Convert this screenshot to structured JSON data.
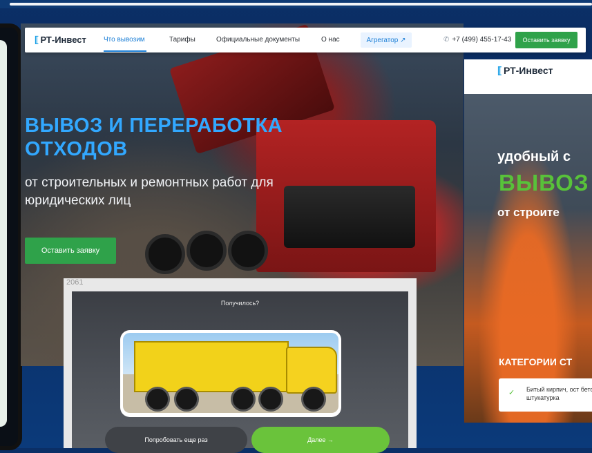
{
  "brand": {
    "name": "РТ-Инвест",
    "glyph": "⟦"
  },
  "nav": {
    "items": [
      {
        "label": "Что вывозим",
        "active": true
      },
      {
        "label": "Тарифы",
        "active": false
      },
      {
        "label": "Официальные документы",
        "active": false
      },
      {
        "label": "О нас",
        "active": false
      }
    ],
    "aggregator_label": "Агрегатор ↗",
    "phone": "+7 (499) 455-17-43",
    "phone_icon": "phone-icon",
    "cta_label": "Оставить заявку"
  },
  "hero": {
    "title": "ВЫВОЗ И ПЕРЕРАБОТКА ОТХОДОВ",
    "subtitle": "от строительных и ремонтных работ для юридических лиц",
    "cta_label": "Оставить заявку"
  },
  "right_panel": {
    "logo": "РТ-Инвест",
    "line1": "удобный с",
    "line2": "ВЫВОЗ",
    "line3": "от строите",
    "category_heading": "КАТЕГОРИИ СТ",
    "card_text": "Битый кирпич, ост бетона, штукатурка"
  },
  "modal": {
    "id_label": "2061",
    "title": "Получилось?",
    "retry_label": "Попробовать еще раз",
    "next_label": "Далее →"
  },
  "colors": {
    "accent_blue": "#32a8ff",
    "accent_green": "#2fa24a",
    "link_blue": "#1c7fd6"
  }
}
